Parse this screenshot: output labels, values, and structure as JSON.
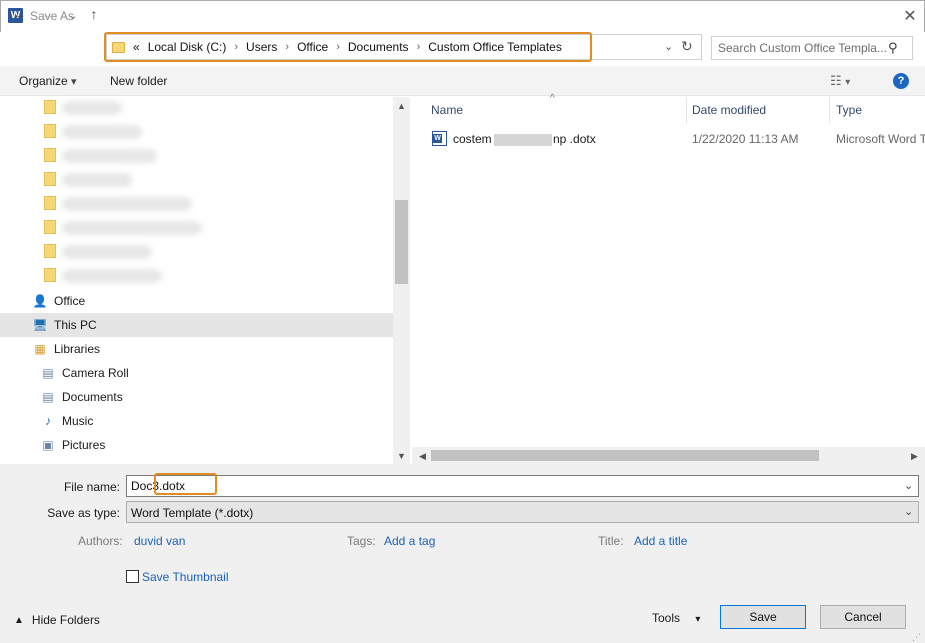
{
  "window": {
    "title": "Save As",
    "app_icon": "W"
  },
  "nav": {
    "back": "←",
    "forward": "→",
    "recent": "⌄",
    "up": "↑",
    "breadcrumb_prefix": "«",
    "breadcrumbs": [
      "Local Disk (C:)",
      "Users",
      "Office",
      "Documents",
      "Custom Office Templates"
    ],
    "search_placeholder": "Search Custom Office Templa..."
  },
  "toolbar": {
    "organize": "Organize",
    "new_folder": "New folder",
    "help": "?"
  },
  "tree": [
    {
      "label": "Office",
      "icon": "user-icon"
    },
    {
      "label": "This PC",
      "icon": "computer-icon",
      "selected": true
    },
    {
      "label": "Libraries",
      "icon": "library-icon"
    },
    {
      "label": "Camera Roll",
      "icon": "library-folder-icon"
    },
    {
      "label": "Documents",
      "icon": "document-library-icon"
    },
    {
      "label": "Music",
      "icon": "music-icon"
    },
    {
      "label": "Pictures",
      "icon": "pictures-icon"
    }
  ],
  "columns": {
    "name": "Name",
    "date": "Date modified",
    "type": "Type"
  },
  "files": [
    {
      "name_start": "costem I",
      "name_end": "np .dotx",
      "date": "1/22/2020 11:13 AM",
      "type": "Microsoft Word T"
    }
  ],
  "form": {
    "filename_label": "File name:",
    "filename_value": "Doc3.dotx",
    "saveas_label": "Save as type:",
    "saveas_value": "Word Template (*.dotx)",
    "authors_label": "Authors:",
    "authors_value": "duvid van",
    "tags_label": "Tags:",
    "tags_value": "Add a tag",
    "title_label": "Title:",
    "title_value": "Add a title",
    "save_thumbnail": "Save Thumbnail"
  },
  "footer": {
    "hide_folders": "Hide Folders",
    "tools": "Tools",
    "save": "Save",
    "cancel": "Cancel"
  },
  "colors": {
    "highlight": "#e18d23",
    "link": "#1a62b8",
    "word_blue": "#2b579a"
  }
}
